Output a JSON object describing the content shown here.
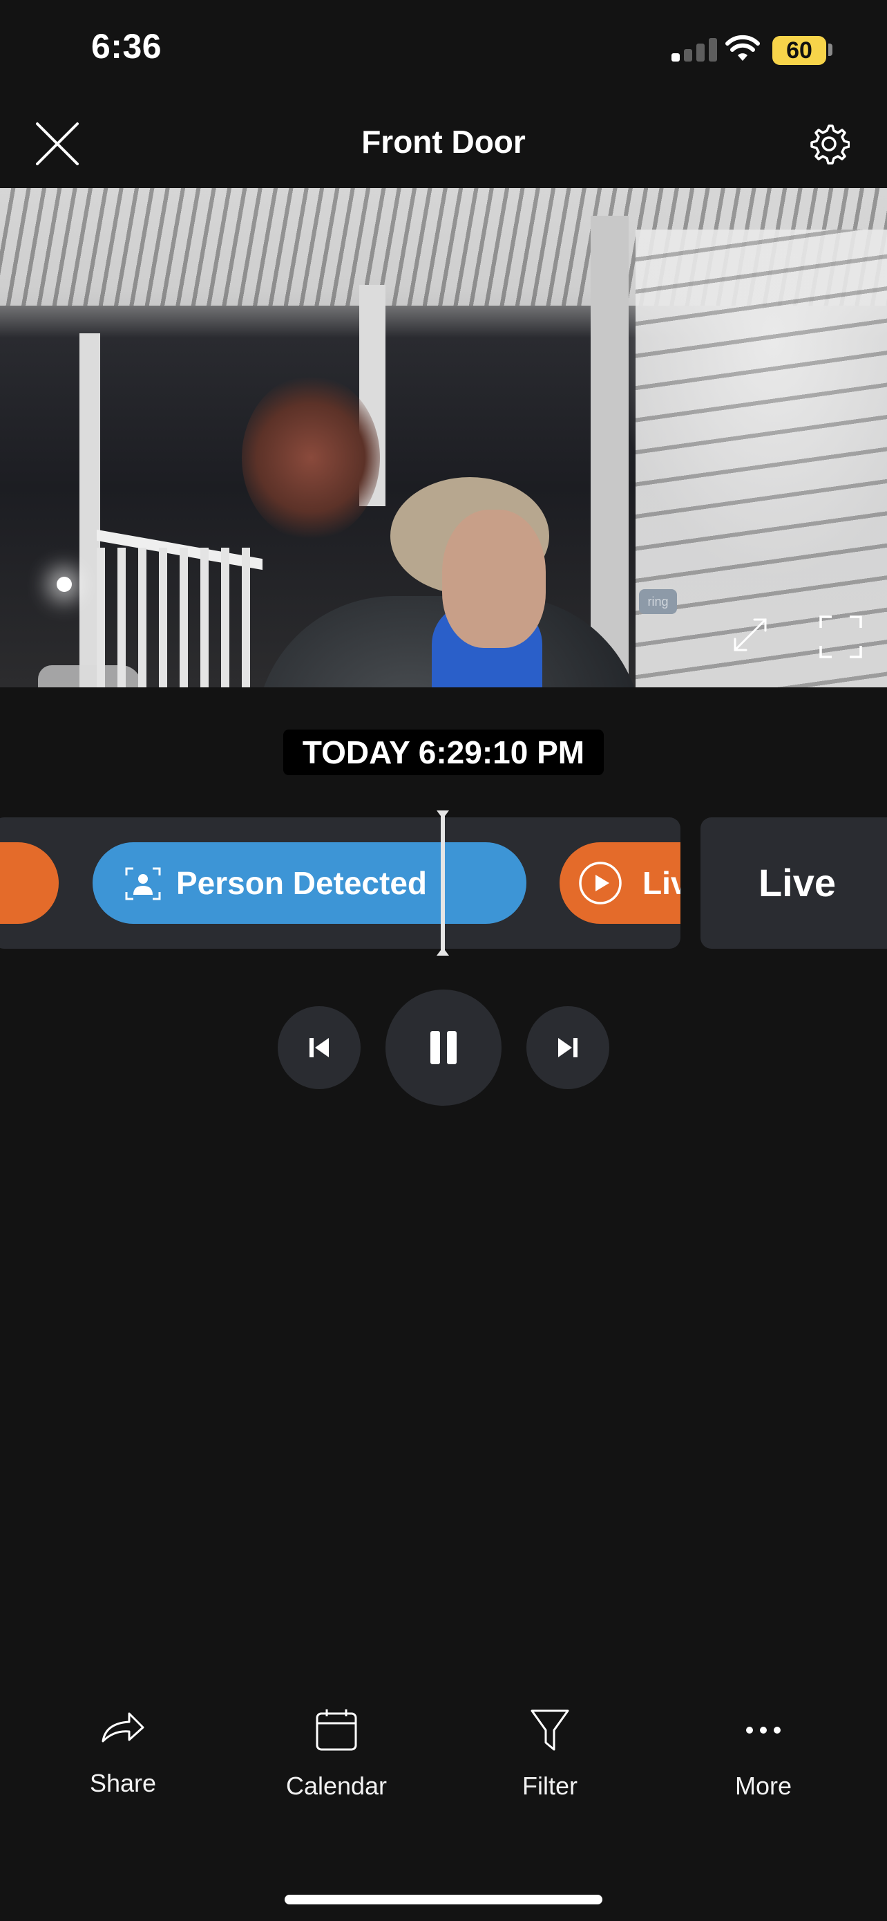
{
  "status_bar": {
    "time": "6:36",
    "battery": "60"
  },
  "header": {
    "title": "Front Door"
  },
  "video": {
    "watermark": "ring"
  },
  "playback": {
    "timestamp": "TODAY 6:29:10 PM"
  },
  "timeline": {
    "events": [
      {
        "label": "Person Detected",
        "color": "#3d95d6",
        "icon": "person-detected-icon"
      },
      {
        "label": "Live",
        "color": "#e46b2a",
        "icon": "play-circle-icon"
      }
    ],
    "live_tile_label": "Live"
  },
  "toolbar": {
    "items": [
      {
        "label": "Share",
        "icon": "share-icon"
      },
      {
        "label": "Calendar",
        "icon": "calendar-icon"
      },
      {
        "label": "Filter",
        "icon": "filter-icon"
      },
      {
        "label": "More",
        "icon": "more-icon"
      }
    ]
  },
  "colors": {
    "background": "#131313",
    "accent_blue": "#3d95d6",
    "accent_orange": "#e46b2a",
    "battery": "#f7d44a"
  }
}
